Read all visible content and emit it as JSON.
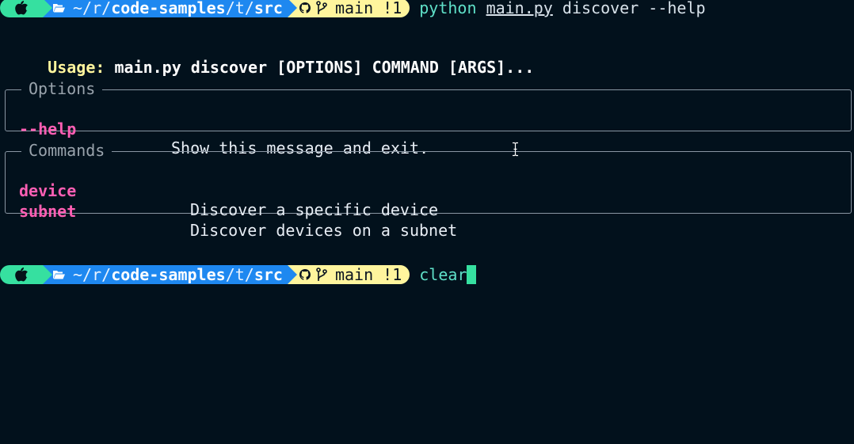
{
  "prompt": {
    "apple_icon": "apple-icon",
    "folder_icon": "folder-open-icon",
    "path_home": "~",
    "path_r": "r",
    "path_repo": "code-samples",
    "path_t": "t",
    "path_src": "src",
    "github_icon": "github-icon",
    "branch_icon": "git-branch-icon",
    "branch": "main",
    "status": "!1"
  },
  "command1": {
    "program": "python",
    "script": "main.py",
    "args": "discover --help"
  },
  "usage": {
    "label": "Usage:",
    "text": "main.py discover [OPTIONS] COMMAND [ARGS]..."
  },
  "options_box": {
    "title": "Options",
    "items": [
      {
        "name": "--help",
        "desc": "Show this message and exit."
      }
    ]
  },
  "commands_box": {
    "title": "Commands",
    "items": [
      {
        "name": "device",
        "desc": "Discover a specific device"
      },
      {
        "name": "subnet",
        "desc": "Discover devices on a subnet"
      }
    ]
  },
  "command2": {
    "text": "clear"
  },
  "colors": {
    "background": "#02111c",
    "prompt_green": "#36e0a0",
    "prompt_blue": "#1e88f0",
    "prompt_yellow": "#fff59d",
    "option_pink": "#ff5fb4",
    "command_teal": "#5fe0c8"
  }
}
